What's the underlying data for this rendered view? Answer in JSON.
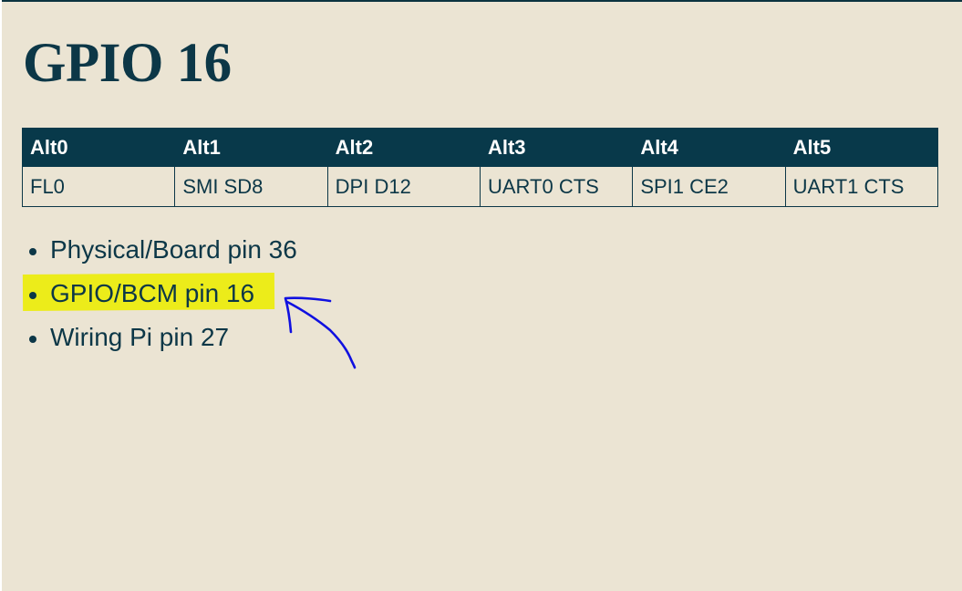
{
  "page": {
    "title": "GPIO 16"
  },
  "alt_table": {
    "headers": [
      "Alt0",
      "Alt1",
      "Alt2",
      "Alt3",
      "Alt4",
      "Alt5"
    ],
    "values": [
      "FL0",
      "SMI SD8",
      "DPI D12",
      "UART0 CTS",
      "SPI1 CE2",
      "UART1 CTS"
    ]
  },
  "pin_list": {
    "items": [
      {
        "label": "Physical/Board pin 36",
        "highlighted": false
      },
      {
        "label": "GPIO/BCM pin 16",
        "highlighted": true
      },
      {
        "label": "Wiring Pi pin 27",
        "highlighted": false
      }
    ]
  },
  "annotation": {
    "highlight_color": "#ecec1a",
    "arrow_color": "#1010e0"
  },
  "colors": {
    "background": "#ebe4d3",
    "header_bg": "#08394a",
    "text": "#0c3747"
  }
}
